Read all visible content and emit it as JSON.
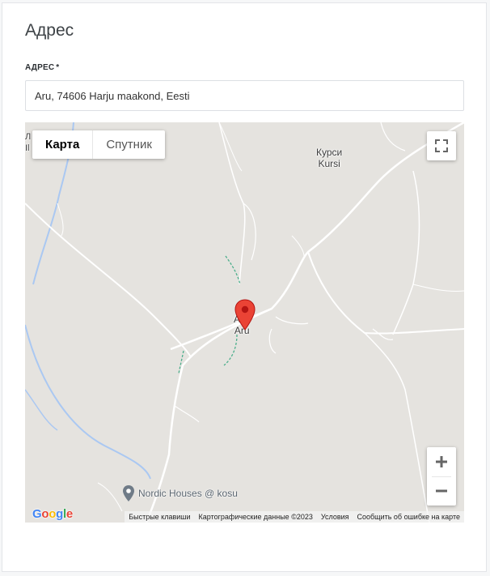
{
  "section": {
    "title": "Адрес"
  },
  "address_field": {
    "label": "АДРЕС",
    "required_mark": "*",
    "value": "Aru, 74606 Harju maakond, Eesti"
  },
  "map": {
    "type_buttons": [
      {
        "label": "Карта",
        "active": true
      },
      {
        "label": "Спутник",
        "active": false
      }
    ],
    "fullscreen_icon": "fullscreen-icon",
    "zoom_in_icon": "plus-icon",
    "zoom_out_icon": "minus-icon",
    "places": {
      "kursi": {
        "line1": "Курси",
        "line2": "Kursi"
      },
      "aru": {
        "line1": "Ару",
        "line2": "Aru"
      },
      "edge": {
        "line1": "Л",
        "line2": "Il"
      }
    },
    "poi": {
      "label": "Nordic Houses @ kosu",
      "icon": "map-pin-icon"
    },
    "logo": "Google",
    "attribution": {
      "shortcuts": "Быстрые клавиши",
      "map_data": "Картографические данные ©2023",
      "terms": "Условия",
      "report": "Сообщить об ошибке на карте"
    },
    "colors": {
      "background": "#e5e3df",
      "road": "#ffffff",
      "water": "#aac8f2",
      "marker": "#ea4335",
      "path_green": "#4caf8c"
    }
  }
}
